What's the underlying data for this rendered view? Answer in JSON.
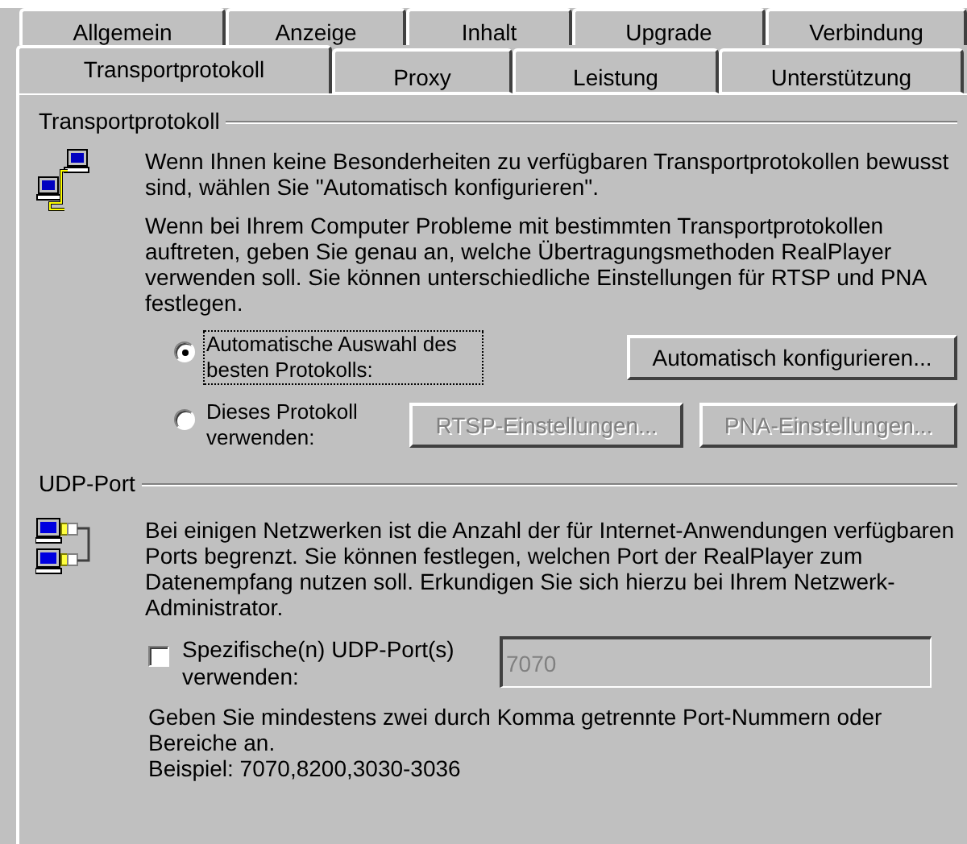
{
  "tabs_back": [
    {
      "label": "Allgemein",
      "selected": false
    },
    {
      "label": "Anzeige",
      "selected": false
    },
    {
      "label": "Inhalt",
      "selected": false
    },
    {
      "label": "Upgrade",
      "selected": false
    },
    {
      "label": "Verbindung",
      "selected": false
    }
  ],
  "tabs_front": [
    {
      "label": "Transportprotokoll",
      "selected": true
    },
    {
      "label": "Proxy",
      "selected": false
    },
    {
      "label": "Leistung",
      "selected": false
    },
    {
      "label": "Unterstützung",
      "selected": false
    }
  ],
  "transport": {
    "title": "Transportprotokoll",
    "intro": "Wenn Ihnen keine Besonderheiten zu verfügbaren Transportprotokollen bewusst sind, wählen Sie \"Automatisch konfigurieren\".",
    "details": "Wenn bei Ihrem Computer Probleme mit bestimmten Transportprotokollen auftreten, geben Sie genau an, welche Übertragungsmethoden RealPlayer verwenden soll. Sie können unterschiedliche Einstellungen für RTSP und PNA festlegen.",
    "options": [
      {
        "label": "Automatische Auswahl des besten Protokolls:",
        "selected": true,
        "buttons": [
          {
            "label": "Automatisch konfigurieren...",
            "disabled": false
          }
        ]
      },
      {
        "label": "Dieses Protokoll verwenden:",
        "selected": false,
        "buttons": [
          {
            "label": "RTSP-Einstellungen...",
            "disabled": true
          },
          {
            "label": "PNA-Einstellungen...",
            "disabled": true
          }
        ]
      }
    ]
  },
  "udp": {
    "title": "UDP-Port",
    "description": "Bei einigen Netzwerken ist die Anzahl der für Internet-Anwendungen verfügbaren Ports begrenzt. Sie können festlegen, welchen Port der RealPlayer zum Datenempfang nutzen soll. Erkundigen Sie sich hierzu bei Ihrem Netzwerk-Administrator.",
    "checkbox": {
      "label": "Spezifische(n) UDP-Port(s) verwenden:",
      "checked": false
    },
    "port_field": {
      "value": "7070",
      "disabled": true
    },
    "hint": "Geben Sie mindestens zwei durch Komma getrennte Port-Nummern oder Bereiche an.",
    "example": "Beispiel: 7070,8200,3030-3036"
  }
}
